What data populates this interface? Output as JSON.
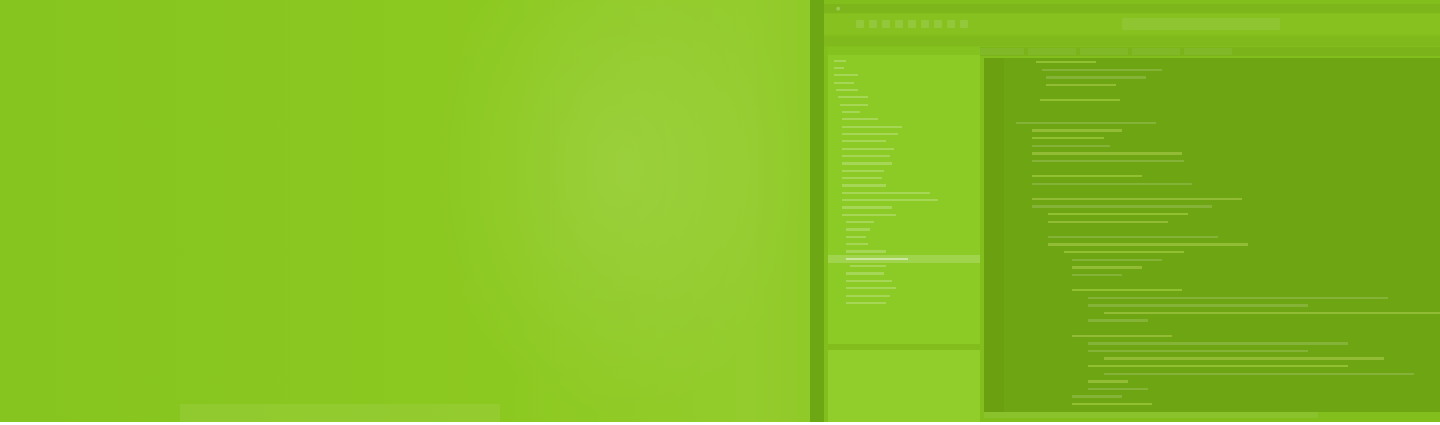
{
  "banner": {
    "background_color": "#8cc920",
    "overlay_color": "#77b017"
  },
  "ide": {
    "menu": [
      "",
      "",
      "",
      "",
      "",
      "",
      "",
      "",
      "",
      ""
    ],
    "toolbar": {
      "search_placeholder": ""
    },
    "tab_label": "",
    "sidebar": {
      "selected_index": 27
    }
  }
}
